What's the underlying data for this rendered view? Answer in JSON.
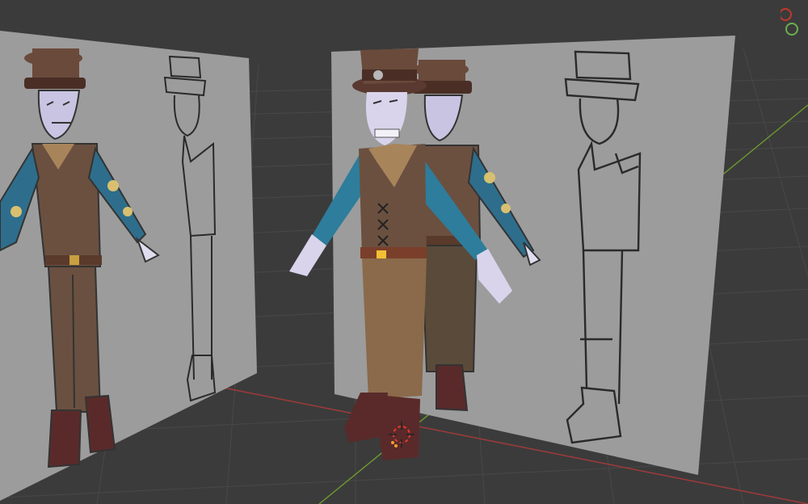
{
  "app": {
    "view": "3D Viewport",
    "shading": "solid"
  },
  "colors": {
    "background": "#3b3b3b",
    "grid_line": "#4a4a4a",
    "x_axis": "#9a3a3a",
    "y_axis": "#6d9b2f",
    "reference_plane": "#9c9c9c",
    "hat": "#6a4a3b",
    "hat_band": "#4a2e25",
    "skin": "#d9d4ec",
    "vest": "#6b5040",
    "collar": "#a8845b",
    "sleeve": "#2e7d9c",
    "belt": "#7a3f2a",
    "buckle": "#f2c035",
    "pants": "#8a6a4a",
    "boot": "#5a2a2a",
    "cursor": "#e23a2f"
  },
  "icons": {
    "cursor": "3d-cursor-icon",
    "gizmo": "navigation-gizmo-icon"
  }
}
